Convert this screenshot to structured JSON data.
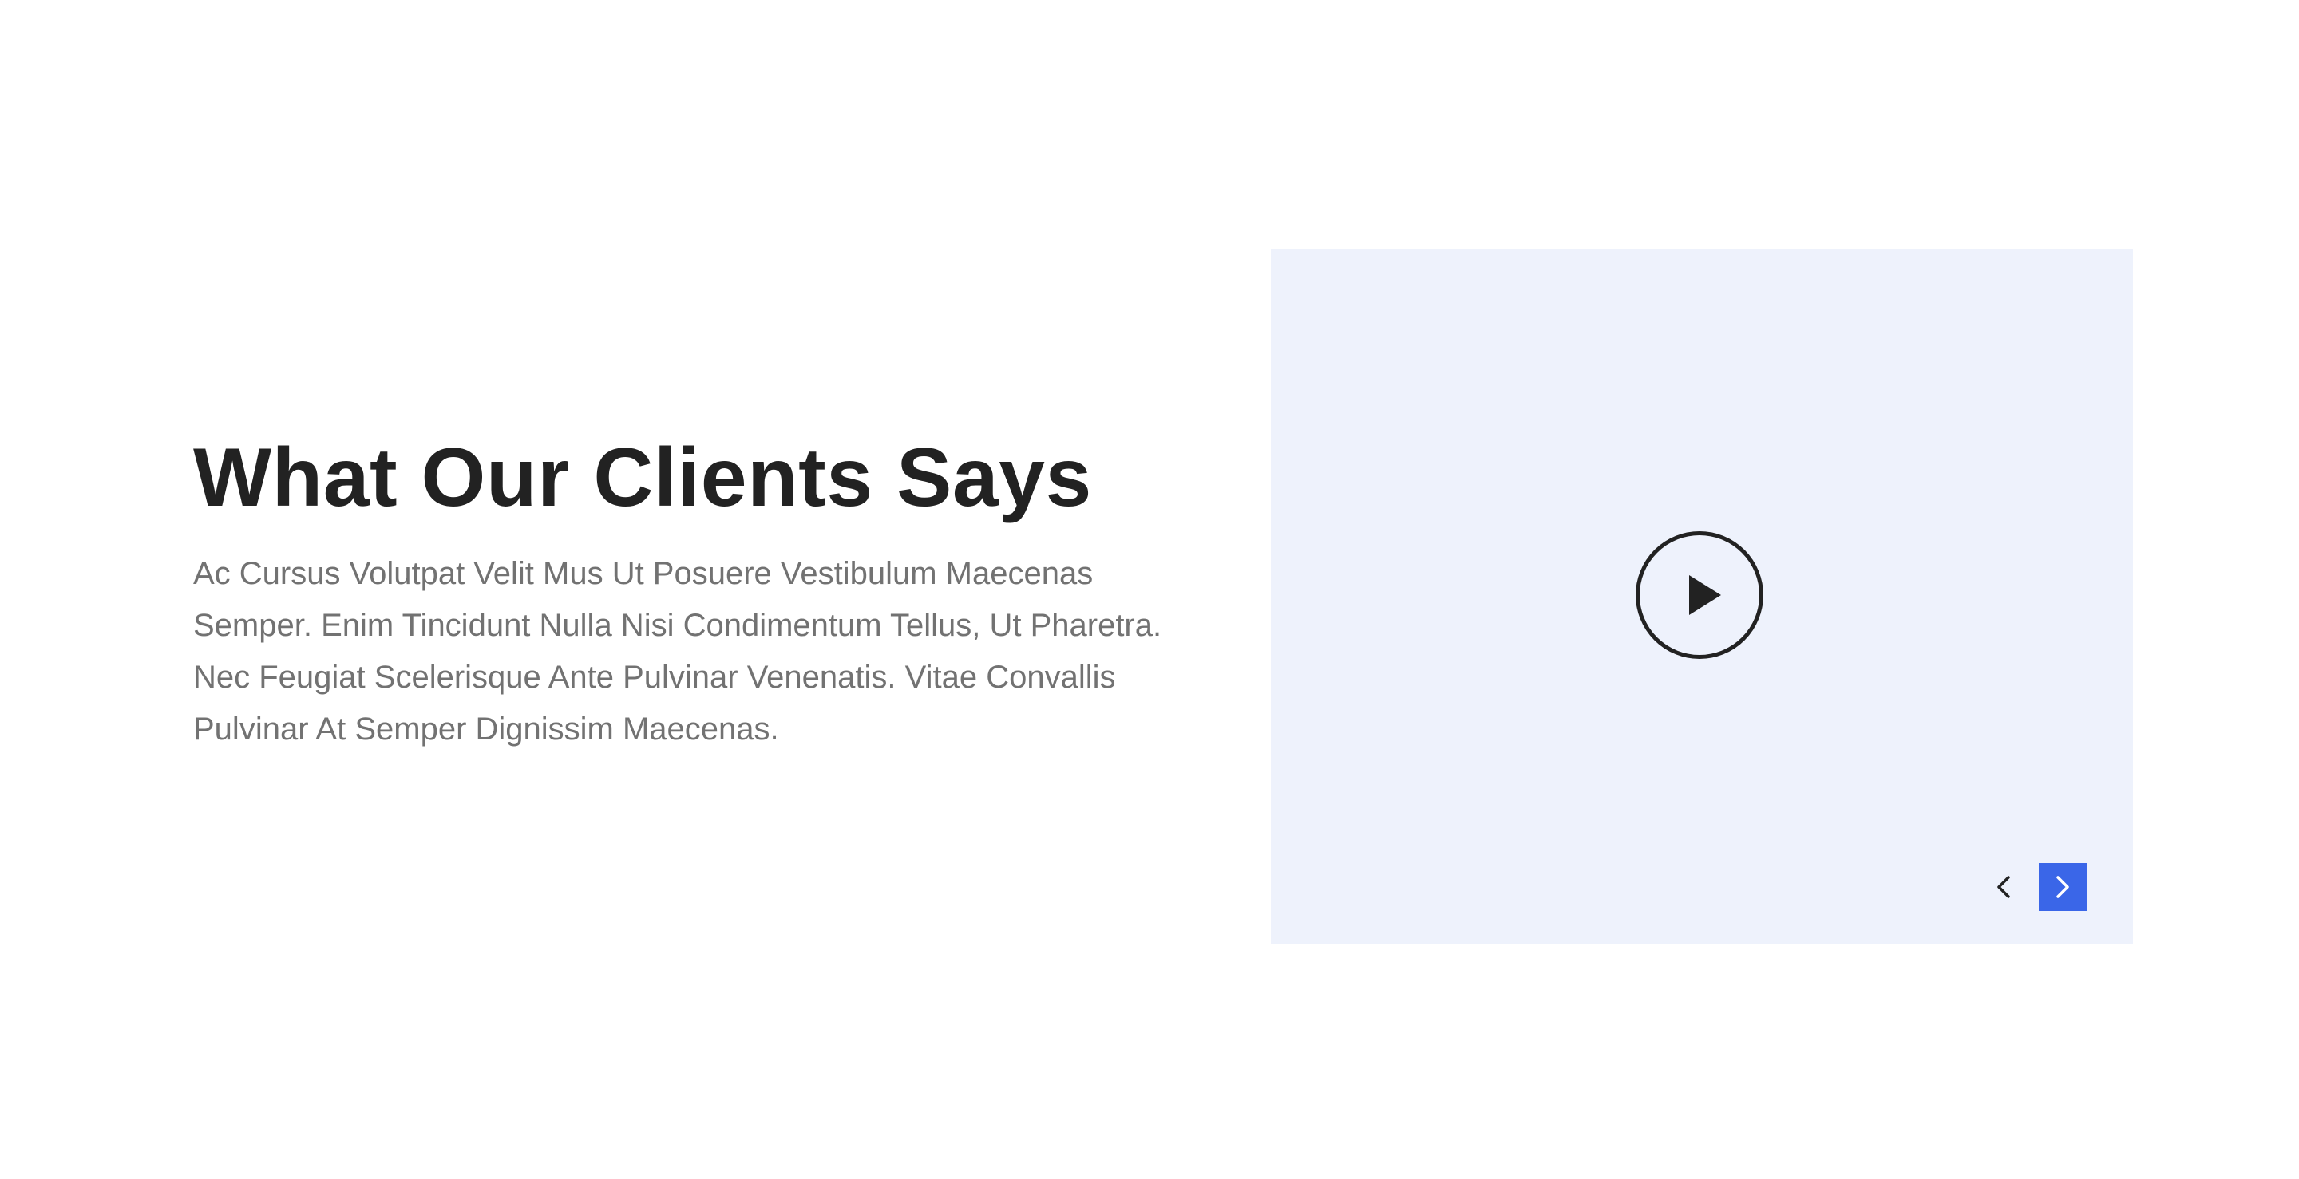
{
  "testimonials": {
    "heading": "What Our Clients Says",
    "description": "Ac Cursus Volutpat Velit Mus Ut Posuere Vestibulum Maecenas Semper. Enim Tincidunt Nulla Nisi Condimentum Tellus, Ut Pharetra. Nec Feugiat Scelerisque Ante Pulvinar Venenatis. Vitae Convallis Pulvinar At Semper Dignissim Maecenas."
  },
  "video": {
    "play_icon": "play-icon",
    "prev_icon": "chevron-left-icon",
    "next_icon": "chevron-right-icon"
  },
  "colors": {
    "heading": "#222222",
    "body_text": "#727272",
    "video_background": "#eef2fc",
    "accent": "#3a66e8"
  }
}
